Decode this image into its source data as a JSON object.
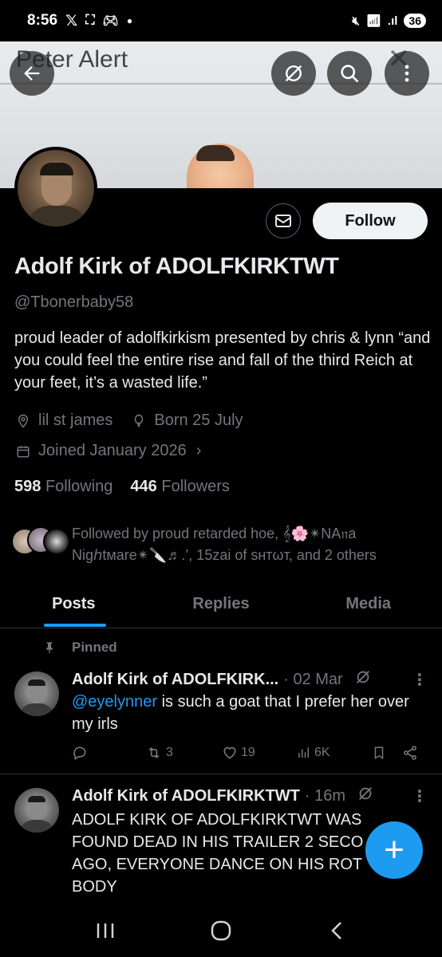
{
  "status_bar": {
    "time": "8:56",
    "battery": "36",
    "icons_left": [
      "x-logo-icon",
      "screenshot-icon",
      "gamepad-icon",
      "dot-icon"
    ],
    "icons_right": [
      "mute-icon",
      "wifi-icon",
      "call-icon",
      "signal-icon"
    ]
  },
  "banner": {
    "title": "Peter Alert"
  },
  "header": {
    "back_icon": "arrow-left-icon",
    "grok_icon": "grok-icon",
    "search_icon": "search-icon",
    "more_icon": "more-vertical-icon"
  },
  "profile": {
    "display_name": "Adolf Kirk of ADOLFKIRKTWT",
    "handle": "@Tbonerbaby58",
    "bio": "proud leader of adolfkirkism presented by chris & lynn “and you could feel the entire rise and fall of the third Reich at your feet, it’s a wasted life.”",
    "location": "lil st james",
    "birthday": "Born 25 July",
    "joined": "Joined January 2026",
    "following_count": "598",
    "following_label": "Following",
    "followers_count": "446",
    "followers_label": "Followers",
    "follow_button": "Follow",
    "followed_by": "Followed by proud retarded hoe, 𝄞🌸✴NA𝔫a Nigℎtмare✴🔪♬.’, 15zai of sнтωт, and 2 others"
  },
  "tabs": [
    {
      "label": "Posts",
      "active": true
    },
    {
      "label": "Replies",
      "active": false
    },
    {
      "label": "Media",
      "active": false
    }
  ],
  "pinned_label": "Pinned",
  "tweets": [
    {
      "name": "Adolf Kirk of ADOLFKIRK...",
      "time": "· 02 Mar",
      "mention": "@eyelynner",
      "text": " is such a goat that I prefer her over my irls",
      "replies": "",
      "retweets": "3",
      "likes": "19",
      "views": "6K"
    },
    {
      "name": "Adolf Kirk of ADOLFKIRKTWT",
      "time": "· 16m",
      "text": "ADOLF KIRK OF ADOLFKIRKTWT WAS FOUND DEAD IN HIS TRAILER 2 SECO AGO, EVERYONE DANCE ON HIS ROT BODY"
    }
  ],
  "fab_label": "+",
  "colors": {
    "accent": "#1d9bf0",
    "text_primary": "#e7e9ea",
    "text_secondary": "#71767b",
    "border": "#2f3336",
    "background": "#000000"
  }
}
